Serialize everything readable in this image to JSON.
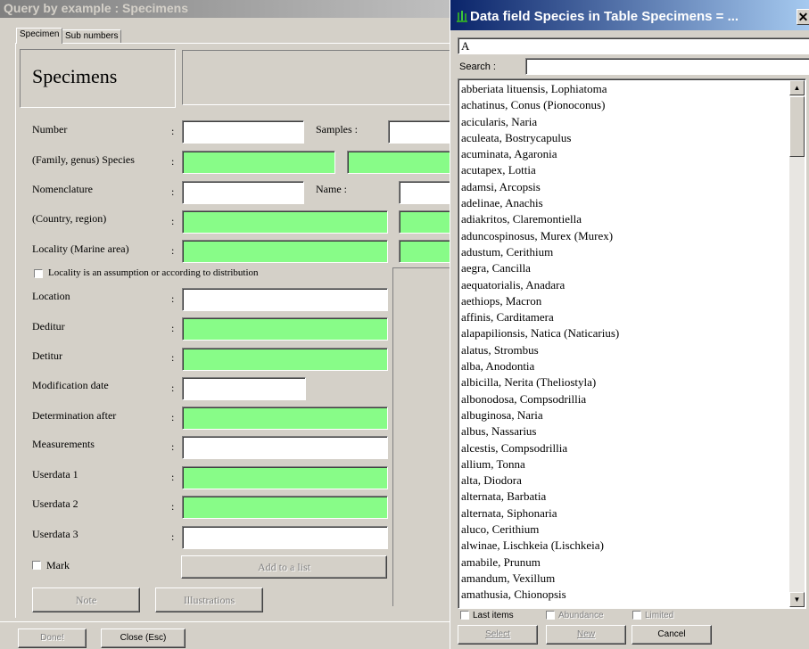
{
  "left_window": {
    "title": "Query by example : Specimens",
    "tabs": [
      "Specimen",
      "Sub numbers"
    ],
    "heading": "Specimens",
    "labels": {
      "number": "Number",
      "samples": "Samples :",
      "species": "(Family, genus) Species",
      "nomenclature": "Nomenclature",
      "name": "Name :",
      "country": "(Country, region)",
      "locality": "Locality (Marine area)",
      "locality_assumption": "Locality is an assumption or according to distribution",
      "location": "Location",
      "deditur": "Deditur",
      "detitur": "Detitur",
      "modification_date": "Modification date",
      "determination_after": "Determination after",
      "measurements": "Measurements",
      "userdata1": "Userdata 1",
      "userdata2": "Userdata 2",
      "userdata3": "Userdata 3",
      "mark": "Mark"
    },
    "colon": ":",
    "buttons": {
      "add_to_list": "Add to a list",
      "note": "Note",
      "illustrations": "Illustrations",
      "done": "Done!",
      "close": "Close (Esc)"
    },
    "colors": {
      "green_field": "#88fc88"
    }
  },
  "right_window": {
    "title": "Data field Species in Table Specimens = ...",
    "close_glyph": "✕",
    "value": "A",
    "search_label": "Search :",
    "search_value": "",
    "items": [
      "abberiata lituensis, Lophiatoma",
      "achatinus, Conus (Pionoconus)",
      "acicularis, Naria",
      "aculeata, Bostrycapulus",
      "acuminata, Agaronia",
      "acutapex, Lottia",
      "adamsi, Arcopsis",
      "adelinae, Anachis",
      "adiakritos, Claremontiella",
      "aduncospinosus, Murex (Murex)",
      "adustum, Cerithium",
      "aegra, Cancilla",
      "aequatorialis, Anadara",
      "aethiops, Macron",
      "affinis, Carditamera",
      "alapapilionsis, Natica (Naticarius)",
      "alatus, Strombus",
      "alba, Anodontia",
      "albicilla, Nerita (Theliostyla)",
      "albonodosa, Compsodrillia",
      "albuginosa, Naria",
      "albus, Nassarius",
      "alcestis, Compsodrillia",
      "allium, Tonna",
      "alta, Diodora",
      "alternata, Barbatia",
      "alternata, Siphonaria",
      "aluco, Cerithium",
      "alwinae, Lischkeia (Lischkeia)",
      "amabile, Prunum",
      "amandum, Vexillum",
      "amathusia, Chionopsis"
    ],
    "options": {
      "last_items": "Last items",
      "abundance": "Abundance",
      "limited": "Limited"
    },
    "buttons": {
      "select": "Select",
      "new": "New",
      "cancel": "Cancel"
    }
  }
}
